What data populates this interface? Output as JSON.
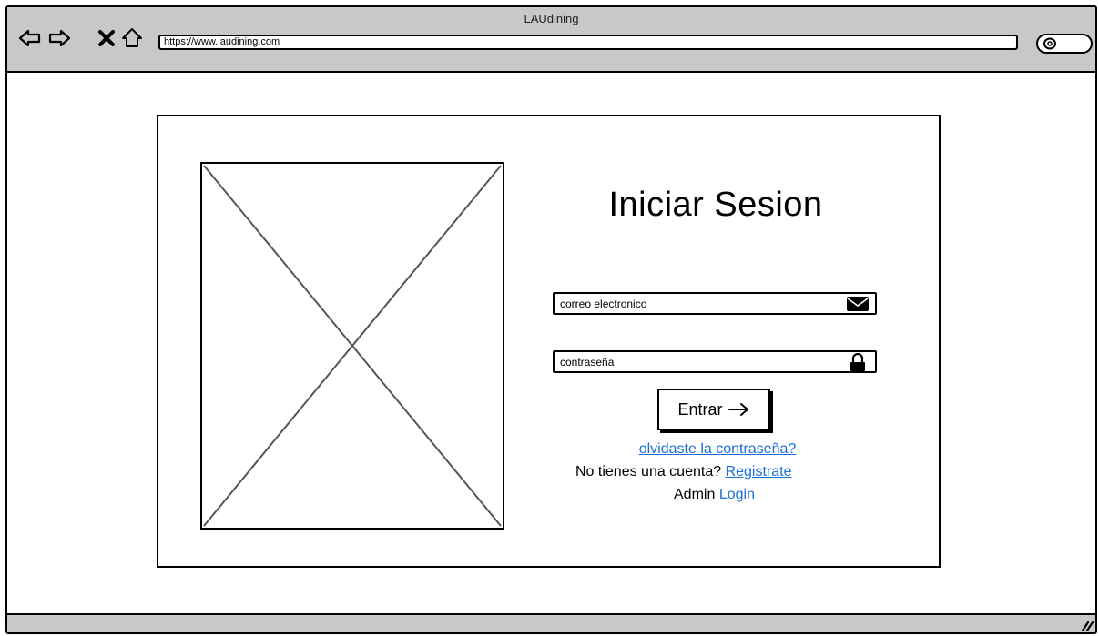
{
  "window": {
    "title": "LAUdining"
  },
  "browser": {
    "url": "https://www.laudining.com",
    "nav_icons": [
      "back-arrow-icon",
      "forward-arrow-icon",
      "close-icon",
      "home-icon"
    ],
    "search_icon": "search-icon"
  },
  "login": {
    "title": "Iniciar Sesion",
    "email_placeholder": "correo electronico",
    "email_icon": "envelope-icon",
    "password_placeholder": "contraseña",
    "password_icon": "lock-icon",
    "enter_label": "Entrar",
    "forgot_link": "olvidaste la contraseña?",
    "no_account_text": "No tienes una cuenta?",
    "register_link": "Registrate",
    "admin_text": "Admin",
    "admin_login_link": "Login"
  },
  "colors": {
    "chrome": "#c8c8c8",
    "link": "#1a6fd9",
    "border": "#000000"
  }
}
